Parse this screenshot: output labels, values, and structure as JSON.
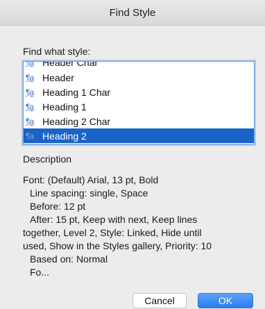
{
  "window": {
    "title": "Find Style"
  },
  "find_label": "Find what style:",
  "styles": [
    {
      "name": "Header Char",
      "icon": "paragraph-char-style-icon",
      "selected": false
    },
    {
      "name": "Header",
      "icon": "paragraph-char-style-icon",
      "selected": false
    },
    {
      "name": "Heading 1 Char",
      "icon": "paragraph-char-style-icon",
      "selected": false
    },
    {
      "name": "Heading 1",
      "icon": "paragraph-char-style-icon",
      "selected": false
    },
    {
      "name": "Heading 2 Char",
      "icon": "paragraph-char-style-icon",
      "selected": false
    },
    {
      "name": "Heading 2",
      "icon": "paragraph-char-style-icon",
      "selected": true
    }
  ],
  "style_icon_glyph": "¶a",
  "description": {
    "heading": "Description",
    "lines": [
      "Font: (Default) Arial, 13 pt, Bold",
      "Line spacing:  single, Space",
      "Before:  12 pt",
      "After:  15 pt, Keep with next, Keep lines",
      "together, Level 2, Style: Linked, Hide until",
      "used, Show in the Styles gallery, Priority: 10",
      "Based on: Normal",
      "Fo..."
    ]
  },
  "buttons": {
    "cancel": "Cancel",
    "ok": "OK"
  },
  "colors": {
    "selection": "#1a63c6",
    "ok_button": "#2a7ef0",
    "focus_ring": "#a9c8f0"
  }
}
